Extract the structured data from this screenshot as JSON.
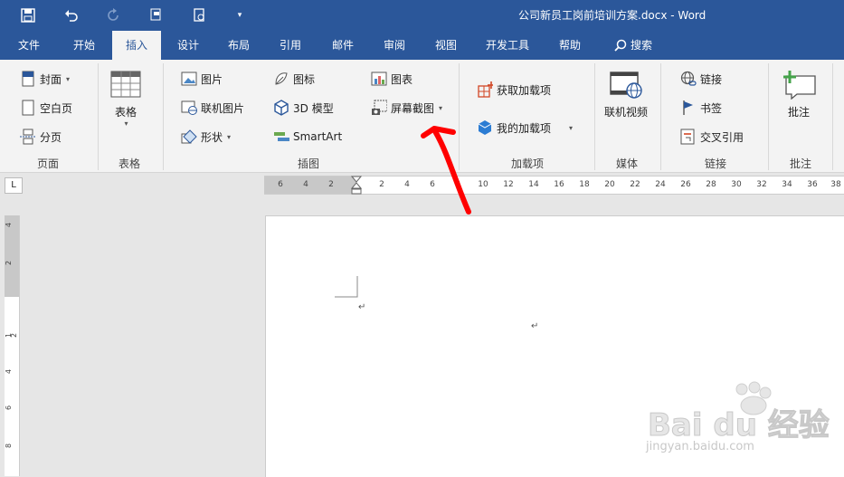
{
  "window": {
    "title": "公司新员工岗前培训方案.docx  -  Word"
  },
  "tabs": [
    {
      "label": "文件"
    },
    {
      "label": "开始"
    },
    {
      "label": "插入"
    },
    {
      "label": "设计"
    },
    {
      "label": "布局"
    },
    {
      "label": "引用"
    },
    {
      "label": "邮件"
    },
    {
      "label": "审阅"
    },
    {
      "label": "视图"
    },
    {
      "label": "开发工具"
    },
    {
      "label": "帮助"
    },
    {
      "label": "搜索"
    }
  ],
  "ribbon": {
    "pages": {
      "cover": "封面",
      "blank": "空白页",
      "break": "分页",
      "label": "页面"
    },
    "tables": {
      "table": "表格",
      "label": "表格"
    },
    "illustrations": {
      "picture": "图片",
      "online_picture": "联机图片",
      "shapes": "形状",
      "icons": "图标",
      "model3d": "3D 模型",
      "smartart": "SmartArt",
      "chart": "图表",
      "screenshot": "屏幕截图",
      "label": "插图"
    },
    "addins": {
      "get": "获取加载项",
      "my": "我的加载项",
      "label": "加载项"
    },
    "media": {
      "online_video": "联机视频",
      "label": "媒体"
    },
    "links": {
      "link": "链接",
      "bookmark": "书签",
      "cross_ref": "交叉引用",
      "label": "链接"
    },
    "comments": {
      "comment": "批注",
      "label": "批注"
    }
  },
  "ruler": {
    "corner": "L",
    "h_ticks": [
      "6",
      "4",
      "2",
      "2",
      "4",
      "6",
      "8",
      "10",
      "12",
      "14",
      "16",
      "18",
      "20",
      "22",
      "24",
      "26",
      "28",
      "30",
      "32",
      "34",
      "36",
      "38"
    ],
    "v_ticks": [
      "4",
      "2",
      "1",
      "2",
      "4",
      "6",
      "8"
    ]
  },
  "document": {
    "para_mark": "↵"
  },
  "watermark": {
    "brand": "Bai du 经验",
    "url": "jingyan.baidu.com"
  },
  "colors": {
    "accent": "#2b579a",
    "annotation": "#ff0000"
  }
}
